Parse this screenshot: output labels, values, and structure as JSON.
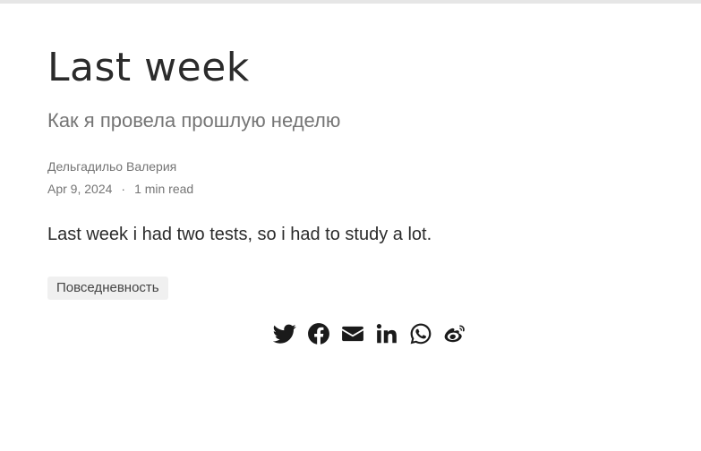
{
  "article": {
    "title": "Last week",
    "subtitle": "Как я провела прошлую неделю",
    "author": "Дельгадильо Валерия",
    "date": "Apr 9, 2024",
    "separator": "·",
    "read_time": "1 min read",
    "body": "Last week i had two tests, so i had to study a lot.",
    "tags": [
      "Повседневность"
    ]
  },
  "share": {
    "icons": [
      "twitter-icon",
      "facebook-icon",
      "email-icon",
      "linkedin-icon",
      "whatsapp-icon",
      "weibo-icon"
    ]
  },
  "colors": {
    "title": "#2b2b2b",
    "muted": "#757575",
    "tag_bg": "#f0f0f0",
    "icon": "#1a1a1a"
  }
}
